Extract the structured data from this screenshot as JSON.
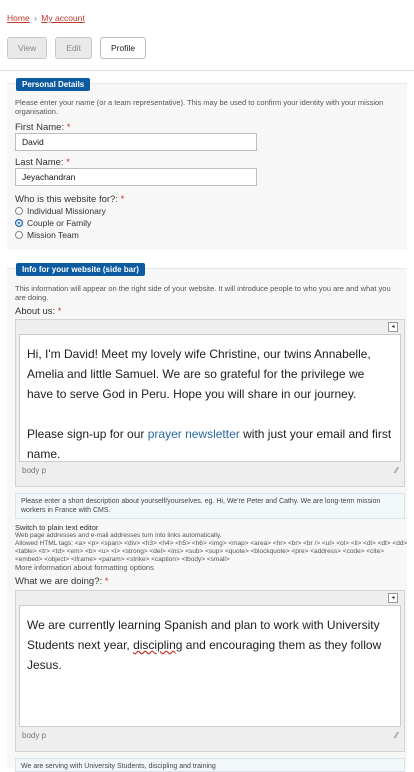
{
  "breadcrumb": {
    "home": "Home",
    "separator": "›",
    "current": "My account"
  },
  "tabs": [
    {
      "label": "View"
    },
    {
      "label": "Edit"
    },
    {
      "label": "Profile"
    }
  ],
  "personal": {
    "legend": "Personal Details",
    "help": "Please enter your name (or a team representative). This may be used to confirm your identity with your mission organisation.",
    "first_name_label": "First Name:",
    "first_name_value": "David",
    "last_name_label": "Last Name:",
    "last_name_value": "Jeyachandran",
    "who_label": "Who is this website for?:",
    "required_mark": "*",
    "options": [
      {
        "label": "Individual Missionary",
        "selected": false
      },
      {
        "label": "Couple or Family",
        "selected": true
      },
      {
        "label": "Mission Team",
        "selected": false
      }
    ]
  },
  "sidebar_info": {
    "legend": "Info for your website (side bar)",
    "help": "This information will appear on the right side of your website. It will introduce people to who you are and what you are doing.",
    "about_label": "About us:",
    "about_p1": "Hi, I'm David! Meet my lovely wife Christine, our twins Annabelle, Amelia and little Samuel. We are so grateful for the privilege we have to serve God in Peru. Hope you will share in our journey.",
    "about_p2_pre": "Please sign-up for our ",
    "about_p2_link": "prayer newsletter",
    "about_p2_post": " with just your email and first name.",
    "editor_path": "body  p",
    "about_note": "Please enter a short description about yourself/yourselves. eg. Hi, We're Peter and Cathy. We are long-term mission workers in France with CMS.",
    "switch_editor": "Switch to plain text editor",
    "format_line1": "Web page addresses and e-mail addresses turn into links automatically.",
    "format_line2": "Allowed HTML tags: <a> <p> <span> <div> <h3> <h4> <h5> <h6> <img> <map> <area> <hr> <br> <br /> <ul> <ol> <li> <dl> <dt> <dd> <table> <tr> <td> <em> <b> <u> <i> <strong> <del> <ins> <sub> <sup> <quote> <blockquote> <pre> <address> <code> <cite> <embed> <object> <iframe> <param> <strike> <caption> <tbody> <small>",
    "more_info": "More information about formatting options",
    "doing_label": "What we are doing?:",
    "doing_pre": "We are currently learning Spanish and plan to work with University Students next year, ",
    "doing_misspelled": "discipling",
    "doing_post": " and encouraging them as they follow Jesus.",
    "doing_note": "We are serving with University Students, discipling and training"
  }
}
